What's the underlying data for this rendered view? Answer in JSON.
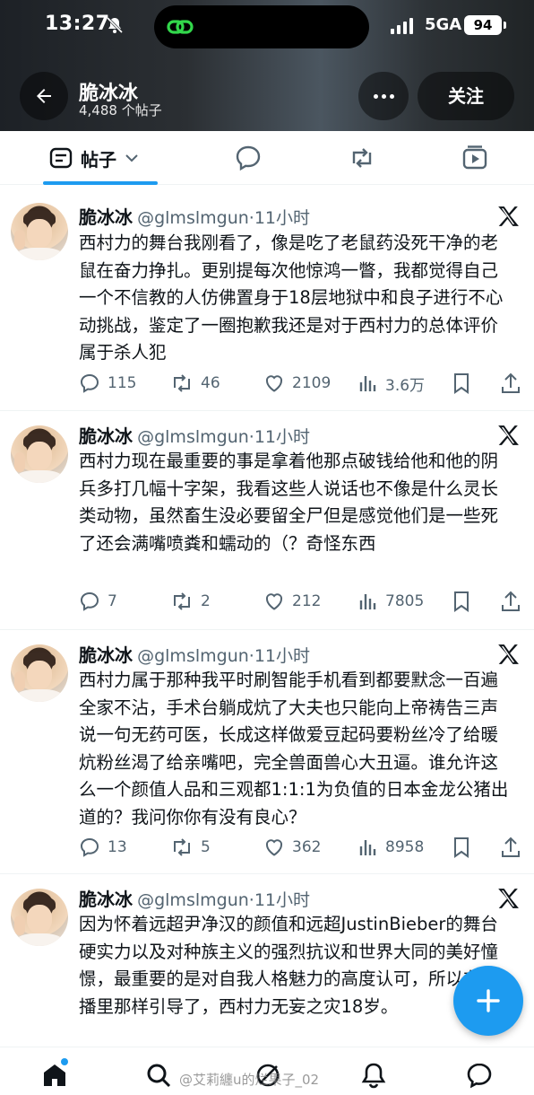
{
  "status_bar": {
    "time": "13:27",
    "network": "5GA",
    "battery": "94"
  },
  "profile": {
    "name": "脆冰冰",
    "post_count": "4,488 个帖子",
    "follow_label": "关注"
  },
  "tabs": {
    "posts_label": "帖子"
  },
  "tweets": [
    {
      "name": "脆冰冰",
      "handle": "@glmslmgun",
      "time": "11小时",
      "text": "西村力的舞台我刚看了，像是吃了老鼠药没死干净的老鼠在奋力挣扎。更别提每次他惊鸿一瞥，我都觉得自己一个不信教的人仿佛置身于18层地狱中和良子进行不心动挑战，鉴定了一圈抱歉我还是对于西村力的总体评价属于杀人犯",
      "replies": "115",
      "retweets": "46",
      "likes": "2109",
      "views": "3.6万"
    },
    {
      "name": "脆冰冰",
      "handle": "@glmslmgun",
      "time": "11小时",
      "text": "西村力现在最重要的事是拿着他那点破钱给他和他的阴兵多打几幅十字架，我看这些人说话也不像是什么灵长类动物，虽然畜生没必要留全尸但是感觉他们是一些死了还会满嘴喷粪和蠕动的（？奇怪东西",
      "replies": "7",
      "retweets": "2",
      "likes": "212",
      "views": "7805"
    },
    {
      "name": "脆冰冰",
      "handle": "@glmslmgun",
      "time": "11小时",
      "text": "西村力属于那种我平时刷智能手机看到都要默念一百遍全家不沾，手术台躺成炕了大夫也只能向上帝祷告三声说一句无药可医，长成这样做爱豆起码要粉丝冷了给暖炕粉丝渴了给亲嘴吧，完全兽面兽心大丑逼。谁允许这么一个颜值人品和三观都1:1:1为负值的日本金龙公猪出道的？我问你你有没有良心？",
      "replies": "13",
      "retweets": "5",
      "likes": "362",
      "views": "8958"
    },
    {
      "name": "脆冰冰",
      "handle": "@glmslmgun",
      "time": "11小时",
      "text": "因为怀着远超尹净汉的颜值和远超JustinBieber的舞台硬实力以及对种族主义的强烈抗议和世界大同的美好憧憬，最重要的是对自我人格魅力的高度认可，所以在直播里那样引导了，西村力无妄之灾18岁。"
    }
  ],
  "watermark": "@艾莉纏u的烂果子_02",
  "colors": {
    "accent": "#1d9bf0",
    "text_primary": "#0f1419",
    "text_secondary": "#536471"
  }
}
